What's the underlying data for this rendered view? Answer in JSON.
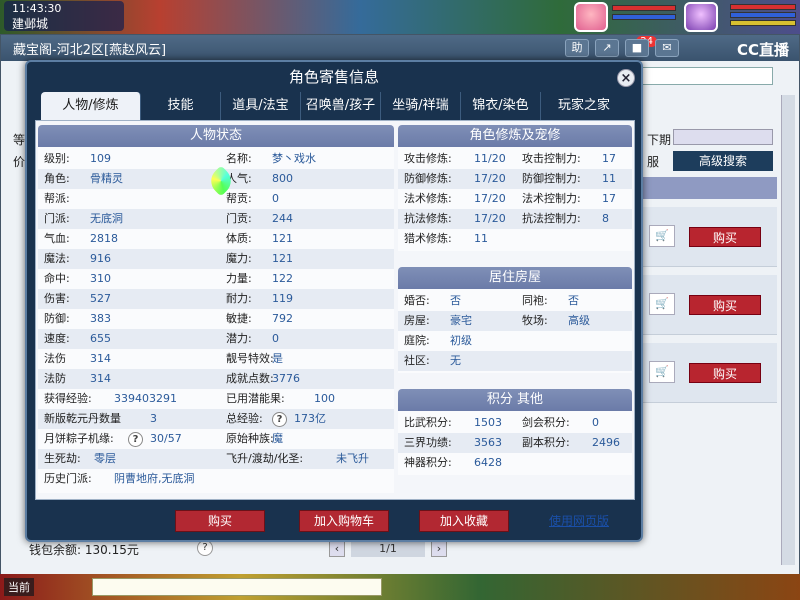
{
  "game": {
    "clock": "11:43:30",
    "city": "建邺城"
  },
  "market": {
    "title": "藏宝阁-河北2区[燕赵风云]",
    "notification_count": "24",
    "stream_logo": "CC直播",
    "labels": {
      "left1": "等",
      "left2": "价",
      "date": "下期",
      "server": "服"
    },
    "advanced_search": "高级搜索",
    "buy_label": "购买",
    "wallet": "钱包余额: 130.15元",
    "page": "1/1"
  },
  "dialog": {
    "title": "角色寄售信息",
    "tabs": [
      "人物/修炼",
      "技能",
      "道具/法宝",
      "召唤兽/孩子",
      "坐骑/祥瑞",
      "锦衣/染色",
      "玩家之家"
    ],
    "status": {
      "title": "人物状态",
      "rows": [
        [
          {
            "l": "级别:",
            "v": "109"
          },
          {
            "l": "名称:",
            "v": "梦丶戏水"
          }
        ],
        [
          {
            "l": "角色:",
            "v": "骨精灵"
          },
          {
            "l": "人气:",
            "v": "800"
          }
        ],
        [
          {
            "l": "帮派:",
            "v": ""
          },
          {
            "l": "帮贡:",
            "v": "0"
          }
        ],
        [
          {
            "l": "门派:",
            "v": "无底洞"
          },
          {
            "l": "门贡:",
            "v": "244"
          }
        ],
        [
          {
            "l": "气血:",
            "v": "2818"
          },
          {
            "l": "体质:",
            "v": "121"
          }
        ],
        [
          {
            "l": "魔法:",
            "v": "916"
          },
          {
            "l": "魔力:",
            "v": "121"
          }
        ],
        [
          {
            "l": "命中:",
            "v": "310"
          },
          {
            "l": "力量:",
            "v": "122"
          }
        ],
        [
          {
            "l": "伤害:",
            "v": "527"
          },
          {
            "l": "耐力:",
            "v": "119"
          }
        ],
        [
          {
            "l": "防御:",
            "v": "383"
          },
          {
            "l": "敏捷:",
            "v": "792"
          }
        ],
        [
          {
            "l": "速度:",
            "v": "655"
          },
          {
            "l": "潜力:",
            "v": "0"
          }
        ],
        [
          {
            "l": "法伤",
            "v": "314"
          },
          {
            "l": "靓号特效:",
            "v": "是"
          }
        ],
        [
          {
            "l": "法防",
            "v": "314"
          },
          {
            "l": "成就点数:",
            "v": "3776"
          }
        ],
        [
          {
            "l": "获得经验:",
            "v": "339403291"
          },
          {
            "l": "已用潜能果:",
            "v": "100"
          }
        ],
        [
          {
            "l": "新版乾元丹数量",
            "v": "3"
          },
          {
            "l": "总经验:",
            "v": "173亿"
          }
        ],
        [
          {
            "l": "月饼粽子机缘:",
            "v": "30/57"
          },
          {
            "l": "原始种族:",
            "v": "魔"
          }
        ],
        [
          {
            "l": "生死劫:",
            "v": "零层"
          },
          {
            "l": "飞升/渡劫/化圣:",
            "v": "未飞升"
          }
        ],
        [
          {
            "l": "历史门派:",
            "v": "阴曹地府,无底洞"
          },
          {
            "l": "",
            "v": ""
          }
        ]
      ]
    },
    "cultivation": {
      "title": "角色修炼及宠修",
      "rows": [
        [
          {
            "l": "攻击修炼:",
            "v": "11/20"
          },
          {
            "l": "攻击控制力:",
            "v": "17"
          }
        ],
        [
          {
            "l": "防御修炼:",
            "v": "17/20"
          },
          {
            "l": "防御控制力:",
            "v": "11"
          }
        ],
        [
          {
            "l": "法术修炼:",
            "v": "17/20"
          },
          {
            "l": "法术控制力:",
            "v": "17"
          }
        ],
        [
          {
            "l": "抗法修炼:",
            "v": "17/20"
          },
          {
            "l": "抗法控制力:",
            "v": "8"
          }
        ],
        [
          {
            "l": "猎术修炼:",
            "v": "11"
          },
          {
            "l": "",
            "v": ""
          }
        ]
      ]
    },
    "housing": {
      "title": "居住房屋",
      "rows": [
        [
          {
            "l": "婚否:",
            "v": "否"
          },
          {
            "l": "同袍:",
            "v": "否"
          }
        ],
        [
          {
            "l": "房屋:",
            "v": "豪宅"
          },
          {
            "l": "牧场:",
            "v": "高级"
          }
        ],
        [
          {
            "l": "庭院:",
            "v": "初级"
          },
          {
            "l": "",
            "v": ""
          }
        ],
        [
          {
            "l": "社区:",
            "v": "无"
          },
          {
            "l": "",
            "v": ""
          }
        ]
      ]
    },
    "points": {
      "title": "积分 其他",
      "rows": [
        [
          {
            "l": "比武积分:",
            "v": "1503"
          },
          {
            "l": "剑会积分:",
            "v": "0"
          }
        ],
        [
          {
            "l": "三界功绩:",
            "v": "3563"
          },
          {
            "l": "副本积分:",
            "v": "2496"
          }
        ],
        [
          {
            "l": "神器积分:",
            "v": "6428"
          },
          {
            "l": "",
            "v": ""
          }
        ]
      ]
    },
    "buttons": {
      "buy": "购买",
      "add_cart": "加入购物车",
      "add_fav": "加入收藏",
      "web_version": "使用网页版"
    }
  },
  "bottom": {
    "left_label": "当前"
  }
}
